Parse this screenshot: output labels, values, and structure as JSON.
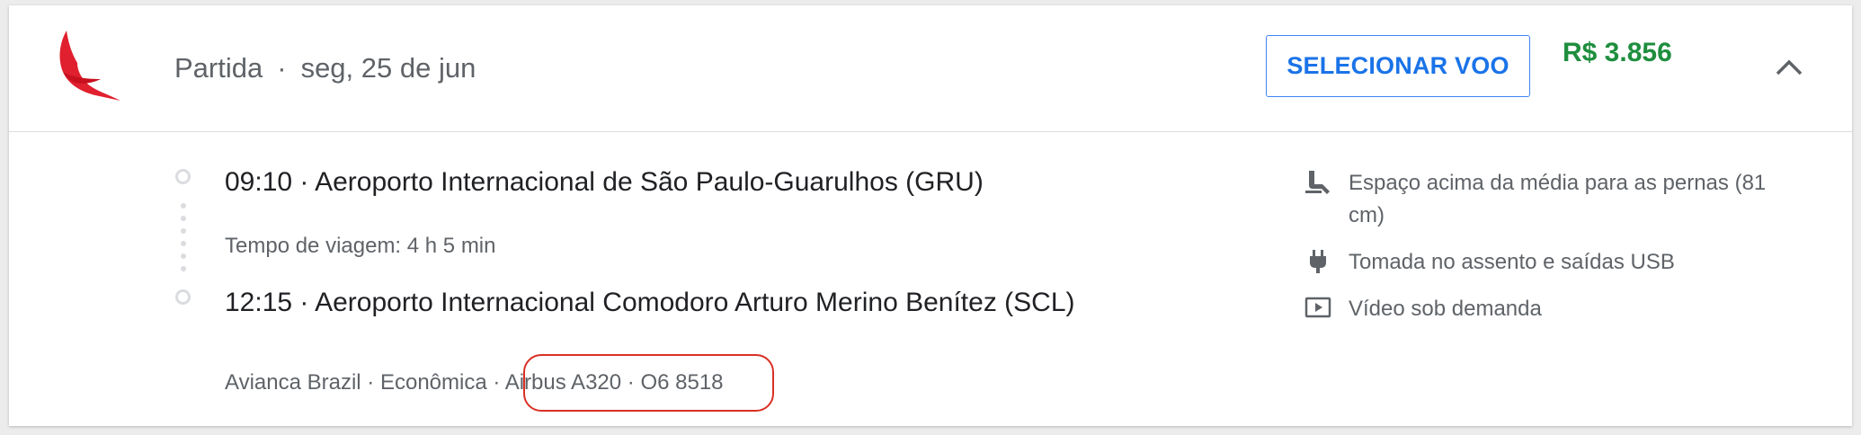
{
  "header": {
    "airline_logo": "avianca-bird-logo",
    "departure_label": "Partida",
    "separator": "·",
    "date": "seg, 25 de jun",
    "select_button": "SELECIONAR VOO",
    "price": "R$ 3.856",
    "collapse_icon": "chevron-up-icon"
  },
  "itinerary": {
    "departure": "09:10 · Aeroporto Internacional de São Paulo-Guarulhos (GRU)",
    "travel_time": "Tempo de viagem: 4 h 5 min",
    "arrival": "12:15 · Aeroporto Internacional Comodoro Arturo Merino Benítez (SCL)",
    "flight_info_prefix": "Avianca Brazil · Econômica · ",
    "flight_info_highlight": "Airbus A320 · O6 8518"
  },
  "amenities": [
    {
      "icon": "legroom-seat-icon",
      "text": "Espaço acima da média para as pernas (81 cm)"
    },
    {
      "icon": "power-plug-icon",
      "text": "Tomada no assento e saídas USB"
    },
    {
      "icon": "video-play-icon",
      "text": "Vídeo sob demanda"
    }
  ],
  "colors": {
    "price": "#1e8e3e",
    "button_border": "#4285f4",
    "button_text": "#1a73e8",
    "highlight_circle": "#d93025",
    "logo": "#e0202e"
  }
}
